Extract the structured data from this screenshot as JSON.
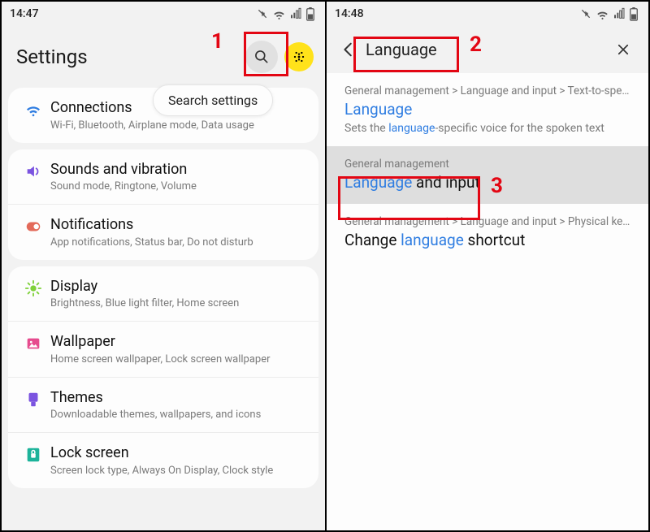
{
  "left": {
    "status_time": "14:47",
    "title": "Settings",
    "tooltip": "Search settings",
    "groups": [
      {
        "items": [
          {
            "icon": "wifi-icon",
            "color": "#2f7de1",
            "title": "Connections",
            "sub": "Wi-Fi, Bluetooth, Airplane mode, Data usage"
          }
        ]
      },
      {
        "items": [
          {
            "icon": "sound-icon",
            "color": "#7b54e0",
            "title": "Sounds and vibration",
            "sub": "Sound mode, Ringtone, Volume"
          },
          {
            "icon": "notif-icon",
            "color": "#e36a5a",
            "title": "Notifications",
            "sub": "App notifications, Status bar, Do not disturb"
          }
        ]
      },
      {
        "items": [
          {
            "icon": "display-icon",
            "color": "#7fd13a",
            "title": "Display",
            "sub": "Brightness, Blue light filter, Home screen"
          },
          {
            "icon": "wallpaper-icon",
            "color": "#e64b8e",
            "title": "Wallpaper",
            "sub": "Home screen wallpaper, Lock screen wallpaper"
          },
          {
            "icon": "themes-icon",
            "color": "#7b54e0",
            "title": "Themes",
            "sub": "Downloadable themes, wallpapers, and icons"
          },
          {
            "icon": "lock-icon",
            "color": "#1cb39a",
            "title": "Lock screen",
            "sub": "Screen lock type, Always On Display, Clock style"
          }
        ]
      }
    ]
  },
  "right": {
    "status_time": "14:48",
    "search_value": "Language",
    "results": [
      {
        "path": "General management > Language and input > Text-to-speech",
        "title_pre": "",
        "title_hl": "Language",
        "title_post": "",
        "desc_pre": "Sets the ",
        "desc_hl": "language",
        "desc_post": "-specific voice for the spoken text",
        "selected": false
      },
      {
        "path": "General management",
        "title_pre": "",
        "title_hl": "Language",
        "title_post": " and input",
        "desc_pre": "",
        "desc_hl": "",
        "desc_post": "",
        "selected": true
      },
      {
        "path": "General management > Language and input > Physical keybo…",
        "title_pre": "Change ",
        "title_hl": "language",
        "title_post": " shortcut",
        "desc_pre": "",
        "desc_hl": "",
        "desc_post": "",
        "selected": false
      }
    ]
  },
  "annotations": {
    "n1": "1",
    "n2": "2",
    "n3": "3"
  }
}
